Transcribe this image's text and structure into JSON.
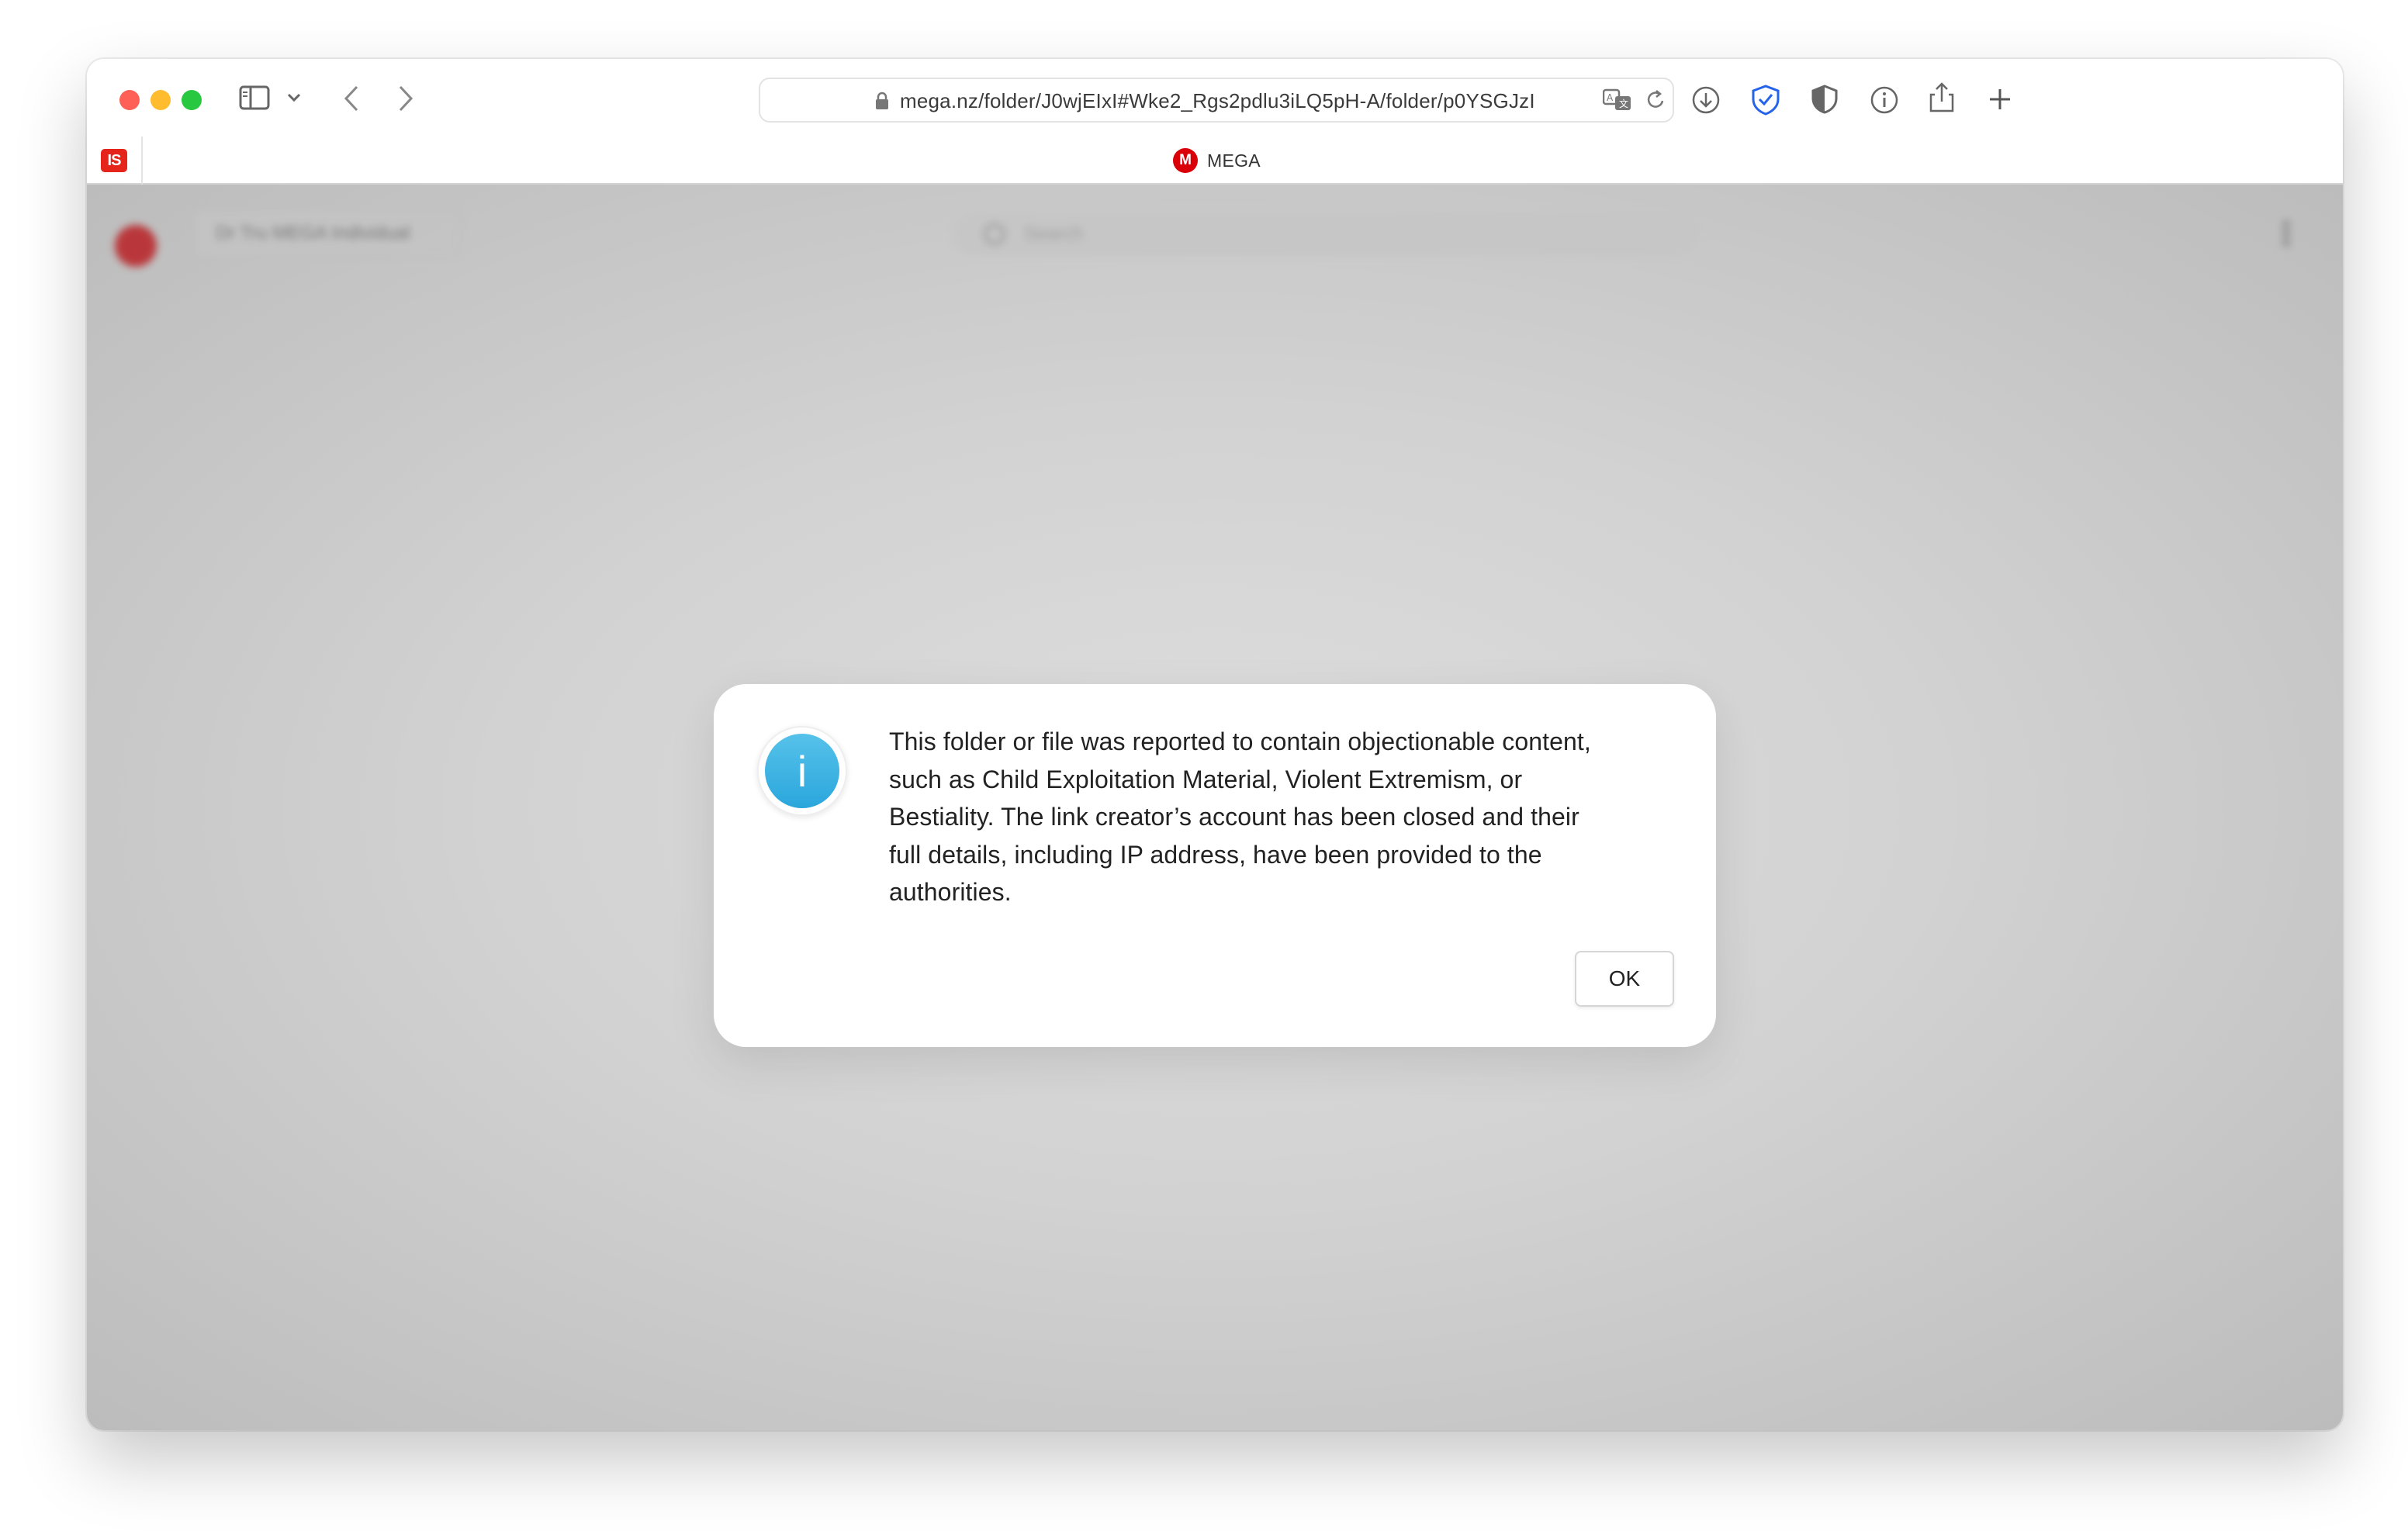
{
  "browser": {
    "url": "mega.nz/folder/J0wjEIxI#Wke2_Rgs2pdlu3iLQ5pH-A/folder/p0YSGJzI",
    "pinned_tab_badge": "IS",
    "active_tab": {
      "logo_letter": "M",
      "title": "MEGA"
    },
    "icons": {
      "sidebar": "sidebar-icon",
      "dropdown": "chevron-down-icon",
      "back": "chevron-left-icon",
      "forward": "chevron-right-icon",
      "lock": "lock-icon",
      "translate": "translate-icon",
      "reload": "reload-icon",
      "downloads": "download-icon",
      "password_manager": "shield-check-icon",
      "privacy": "shield-half-icon",
      "info": "info-icon",
      "share": "share-icon",
      "new_tab": "plus-icon"
    }
  },
  "background_page": {
    "account_button_label": "Dr Tru MEGA Individual",
    "search_placeholder": "Search"
  },
  "dialog": {
    "icon_glyph": "i",
    "message": "This folder or file was reported to contain objectionable content, such as Child Exploitation Material, Violent Extremism, or Bestiality. The link creator’s account has been closed and their full details, including IP address, have been provided to the authorities.",
    "ok_label": "OK"
  },
  "colors": {
    "info_icon": "#2aa6dc",
    "mega_red": "#d90007",
    "password_manager_blue": "#2563eb"
  }
}
